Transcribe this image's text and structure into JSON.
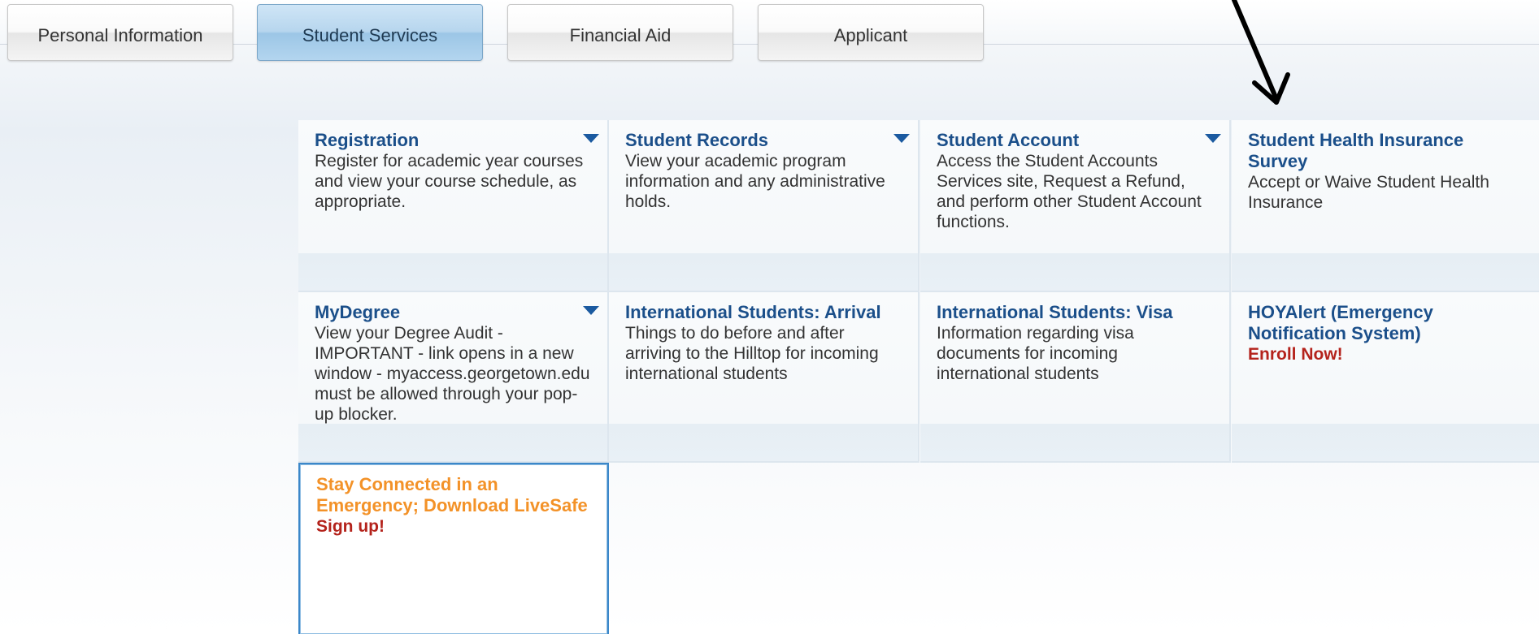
{
  "tabs": [
    {
      "label": "Personal Information",
      "active": false
    },
    {
      "label": "Student Services",
      "active": true
    },
    {
      "label": "Financial Aid",
      "active": false
    },
    {
      "label": "Applicant",
      "active": false
    }
  ],
  "annotation": {
    "icon": "arrow-down-icon",
    "color": "#000000"
  },
  "services": [
    {
      "title": "Registration",
      "description": "Register for academic year courses and view your course schedule, as appropriate.",
      "has_dropdown": true
    },
    {
      "title": "Student Records",
      "description": "View your academic program information and any administrative holds.",
      "has_dropdown": true
    },
    {
      "title": "Student Account",
      "description": "Access the Student Accounts Services site, Request a Refund, and perform other Student Account functions.",
      "has_dropdown": true
    },
    {
      "title": "Student Health Insurance Survey",
      "description": "Accept or Waive Student Health Insurance",
      "has_dropdown": false
    },
    {
      "title": "MyDegree",
      "description": "View your Degree Audit - IMPORTANT - link opens in a new window - myaccess.georgetown.edu must be allowed through your pop-up blocker.",
      "has_dropdown": true
    },
    {
      "title": "International Students: Arrival",
      "description": "Things to do before and after arriving to the Hilltop for incoming international students",
      "has_dropdown": false
    },
    {
      "title": "International Students: Visa",
      "description": "Information regarding visa documents for incoming international students",
      "has_dropdown": false
    },
    {
      "title": "HOYAlert (Emergency Notification System)",
      "action": "Enroll Now!",
      "has_dropdown": false
    },
    {
      "title": "Stay Connected in an Emergency; Download LiveSafe",
      "action": "Sign up!",
      "has_dropdown": false,
      "selected": true
    }
  ],
  "colors": {
    "link_blue": "#1b4f8a",
    "action_red": "#b4231c",
    "highlight_orange": "#f39228",
    "active_tab": "#b7d6ee"
  }
}
